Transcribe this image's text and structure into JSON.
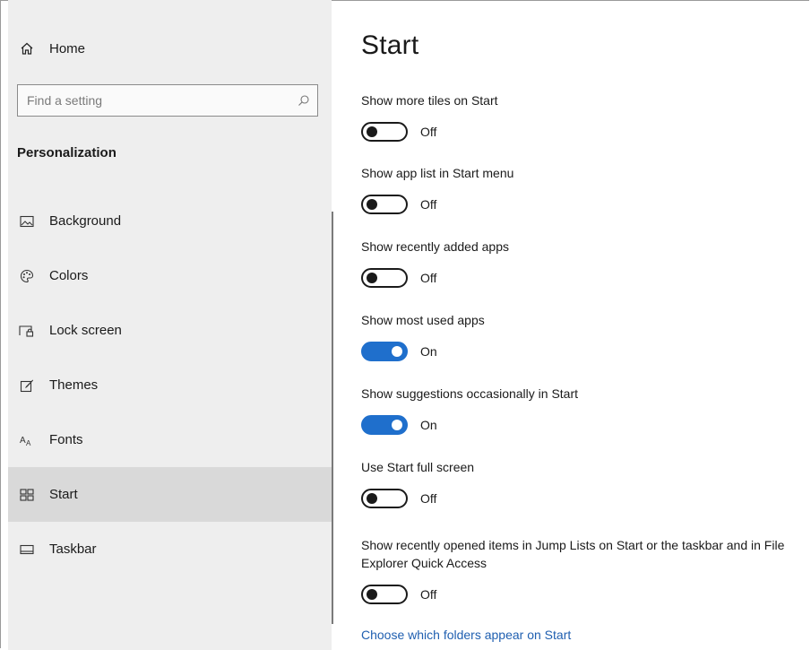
{
  "sidebar": {
    "home_label": "Home",
    "search_placeholder": "Find a setting",
    "section_title": "Personalization",
    "items": [
      {
        "label": "Background",
        "icon": "picture-icon"
      },
      {
        "label": "Colors",
        "icon": "palette-icon"
      },
      {
        "label": "Lock screen",
        "icon": "lock-screen-icon"
      },
      {
        "label": "Themes",
        "icon": "brush-icon"
      },
      {
        "label": "Fonts",
        "icon": "fonts-icon"
      },
      {
        "label": "Start",
        "icon": "start-tiles-icon",
        "selected": true
      },
      {
        "label": "Taskbar",
        "icon": "taskbar-icon"
      }
    ]
  },
  "main": {
    "title": "Start",
    "settings": [
      {
        "label": "Show more tiles on Start",
        "state": "Off",
        "on": false
      },
      {
        "label": "Show app list in Start menu",
        "state": "Off",
        "on": false
      },
      {
        "label": "Show recently added apps",
        "state": "Off",
        "on": false
      },
      {
        "label": "Show most used apps",
        "state": "On",
        "on": true
      },
      {
        "label": "Show suggestions occasionally in Start",
        "state": "On",
        "on": true
      },
      {
        "label": "Use Start full screen",
        "state": "Off",
        "on": false
      },
      {
        "label": "Show recently opened items in Jump Lists on Start or the taskbar and in File Explorer Quick Access",
        "state": "Off",
        "on": false
      }
    ],
    "link_label": "Choose which folders appear on Start"
  },
  "colors": {
    "accent": "#1f6fcc",
    "link": "#1f5fb0",
    "sidebar_bg": "#eeeeee",
    "selected_bg": "#d9d9d9"
  }
}
